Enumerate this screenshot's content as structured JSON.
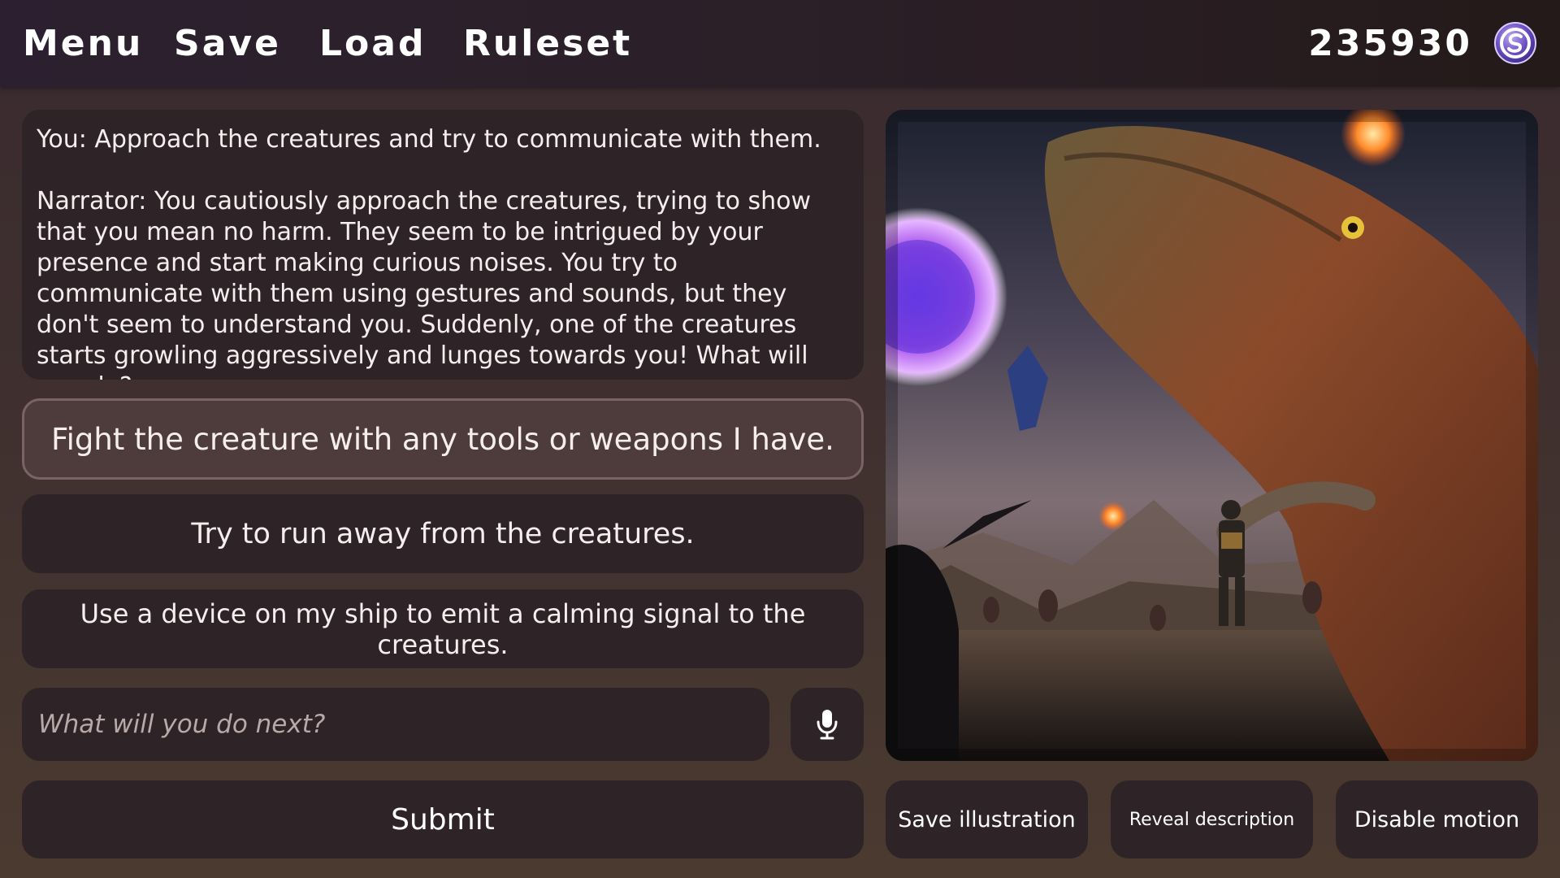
{
  "nav": {
    "menu": "Menu",
    "save": "Save",
    "load": "Load",
    "ruleset": "Ruleset"
  },
  "credits": {
    "value": "235930",
    "icon": "currency-s-coin-icon"
  },
  "story": {
    "text": "You: Approach the creatures and try to communicate with them.\n\nNarrator: You cautiously approach the creatures, trying to show that you mean no harm. They seem to be intrigued by your presence and start making curious noises. You try to communicate with them using gestures and sounds, but they don't seem to understand you. Suddenly, one of the creatures starts growling aggressively and lunges towards you! What will you do?"
  },
  "choices": [
    {
      "label": "Fight the creature with any tools or weapons I have.",
      "selected": true
    },
    {
      "label": "Try to run away from the creatures."
    },
    {
      "label": "Use a device on my ship to emit a calming signal to the creatures."
    }
  ],
  "input": {
    "placeholder": "What will you do next?",
    "value": ""
  },
  "mic": {
    "icon": "microphone-icon"
  },
  "submit": {
    "label": "Submit"
  },
  "illustration": {
    "subject": "giant reptile creature, armored explorer and small alien creatures on a barren planet under a glowing purple orb"
  },
  "actions": {
    "save_illustration": "Save illustration",
    "reveal_description": "Reveal description",
    "disable_motion": "Disable motion"
  },
  "colors": {
    "panel": "#2e2326",
    "selected_choice": "#4e3c3c",
    "text": "#f6eeee",
    "accent_coin": "#7a5cc8"
  }
}
